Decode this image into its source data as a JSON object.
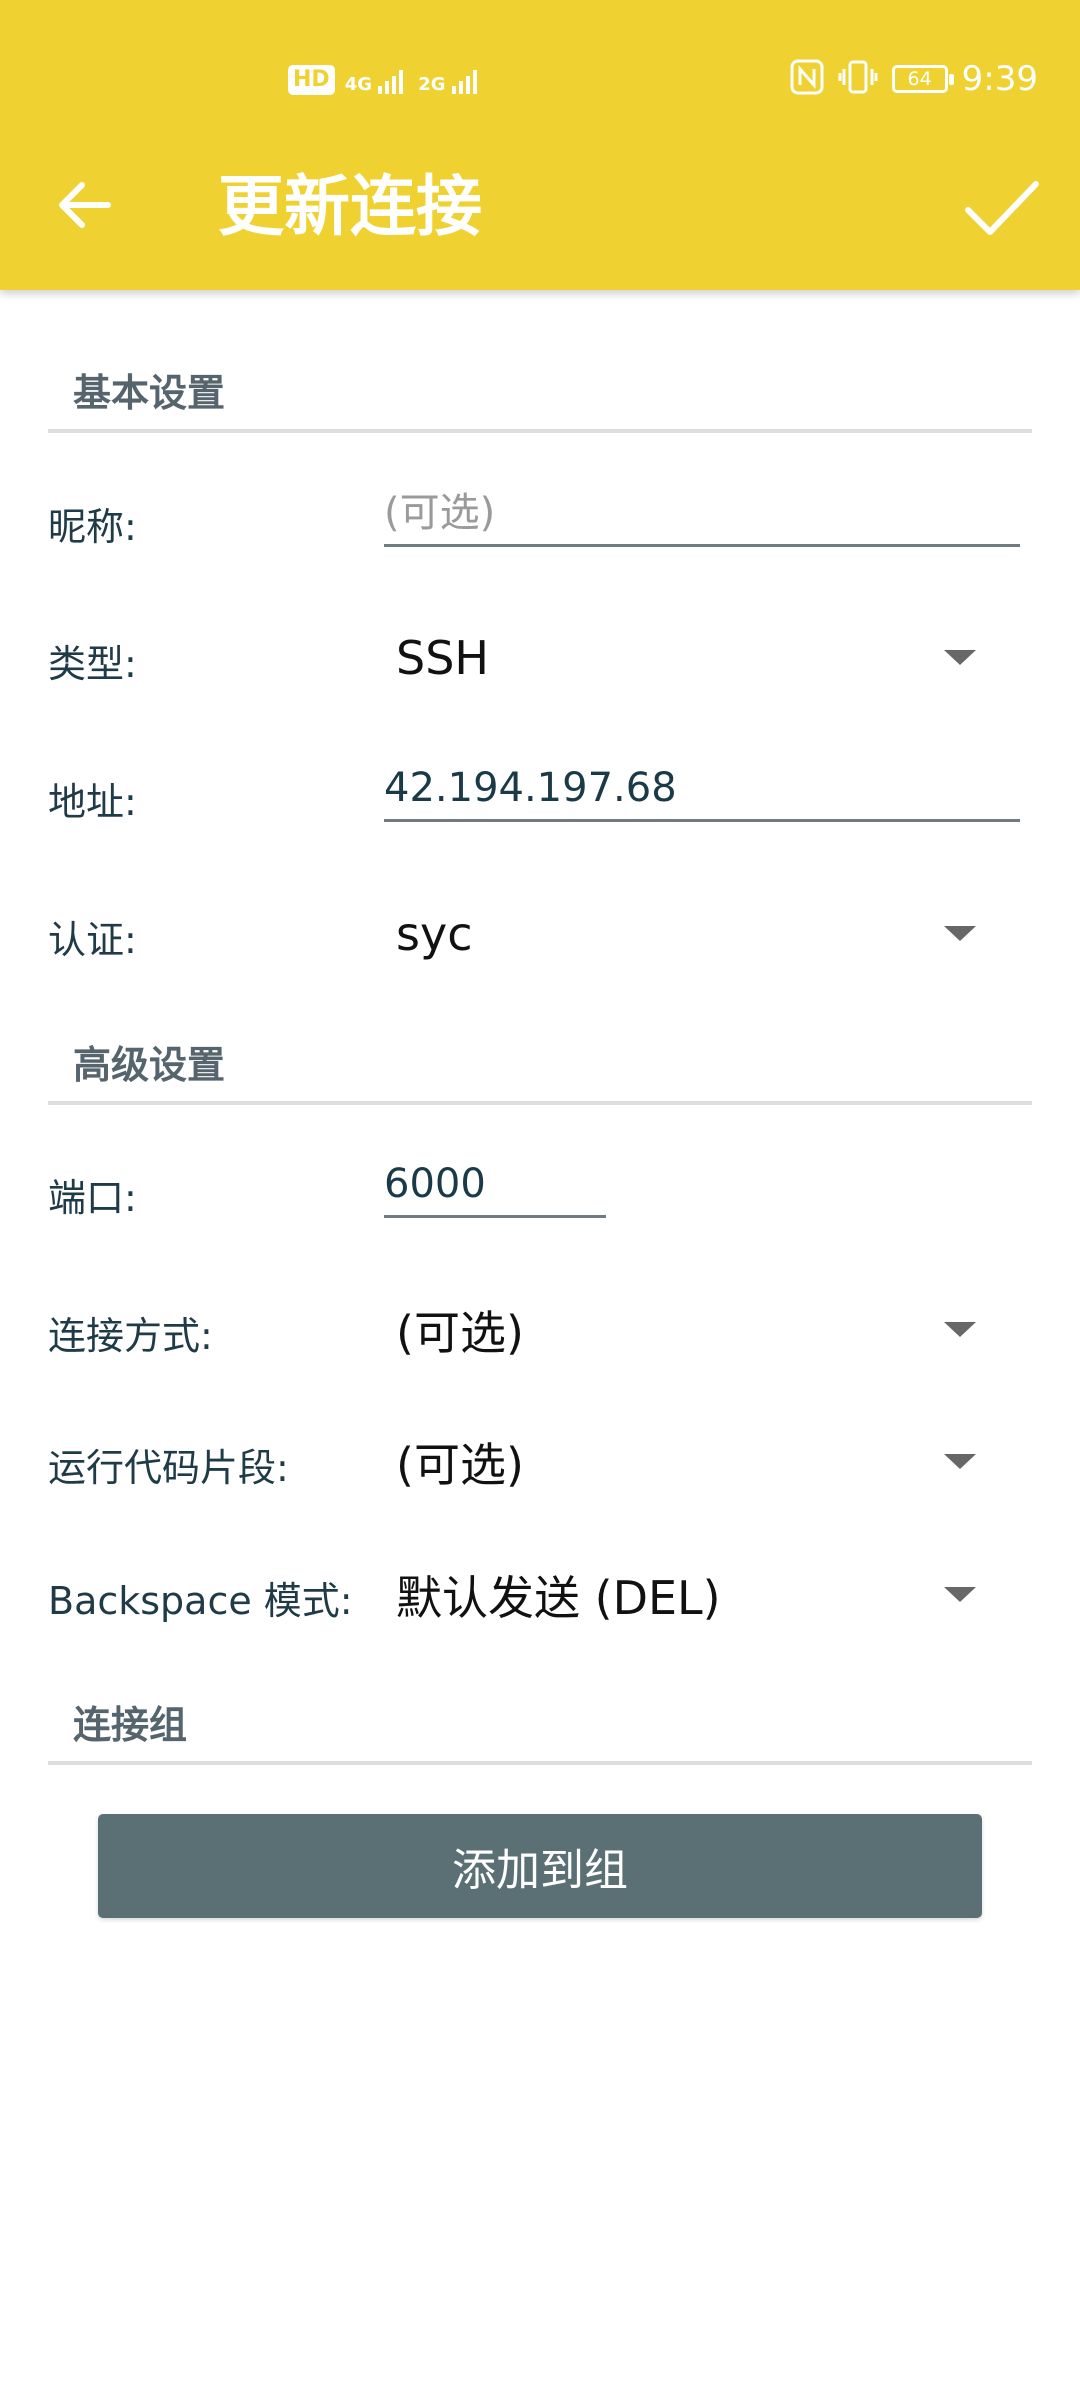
{
  "status_bar": {
    "hd_label": "HD",
    "sim1_tech": "4G",
    "sim2_tech": "2G",
    "battery_level": "64",
    "time": "9:39",
    "icons": [
      "hd-icon",
      "signal-4g-icon",
      "signal-2g-icon",
      "nfc-icon",
      "vibrate-icon",
      "battery-icon"
    ]
  },
  "app_bar": {
    "title": "更新连接",
    "back_icon": "arrow-left-icon",
    "confirm_icon": "check-icon",
    "background_color": "#efd232"
  },
  "sections": {
    "basic": "基本设置",
    "advanced": "高级设置",
    "group": "连接组"
  },
  "form": {
    "nickname": {
      "label": "昵称:",
      "value": "",
      "placeholder": "(可选)"
    },
    "type": {
      "label": "类型:",
      "value": "SSH"
    },
    "address": {
      "label": "地址:",
      "value": "42.194.197.68"
    },
    "auth": {
      "label": "认证:",
      "value": "syc"
    },
    "port": {
      "label": "端口:",
      "value": "6000"
    },
    "connection_method": {
      "label": "连接方式:",
      "value": "(可选)"
    },
    "run_snippet": {
      "label": "运行代码片段:",
      "value": "(可选)"
    },
    "backspace_mode": {
      "label": "Backspace 模式:",
      "value": "默认发送 (DEL)"
    }
  },
  "buttons": {
    "add_to_group": "添加到组"
  },
  "colors": {
    "accent": "#efd232",
    "button": "#5a7075",
    "label_text": "#1f3b47",
    "section_text": "#56656d"
  }
}
